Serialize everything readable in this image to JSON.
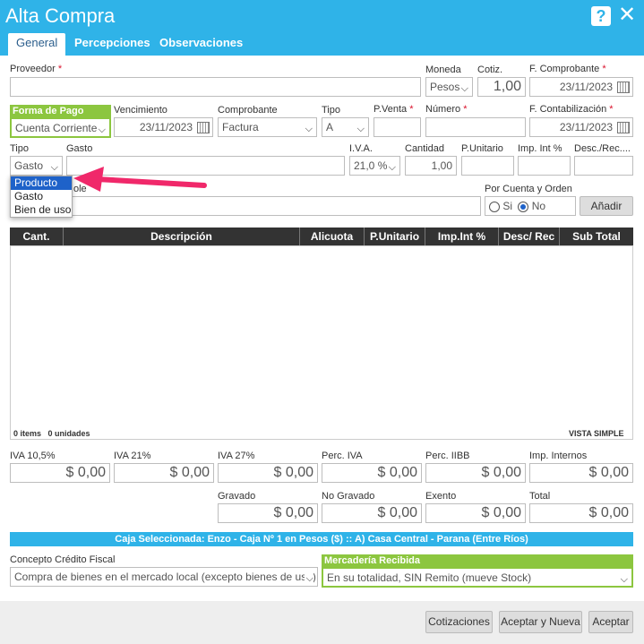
{
  "window": {
    "title": "Alta Compra"
  },
  "tabs": [
    {
      "label": "General"
    },
    {
      "label": "Percepciones"
    },
    {
      "label": "Observaciones"
    }
  ],
  "labels": {
    "proveedor": "Proveedor",
    "moneda": "Moneda",
    "cotiz": "Cotiz.",
    "f_comprobante": "F. Comprobante",
    "forma_pago": "Forma de Pago",
    "vencimiento": "Vencimiento",
    "comprobante": "Comprobante",
    "tipo": "Tipo",
    "pventa": "P.Venta",
    "numero": "Número",
    "f_contabilizacion": "F. Contabilización",
    "tipo2": "Tipo",
    "gasto": "Gasto",
    "iva": "I.V.A.",
    "cantidad": "Cantidad",
    "punitario": "P.Unitario",
    "imp_int": "Imp. Int %",
    "desc_rec": "Desc./Rec....",
    "imputable_suffix": "ole",
    "por_cuenta": "Por Cuenta y Orden",
    "si": "Si",
    "no": "No",
    "required_mark": "*"
  },
  "fields": {
    "proveedor": "",
    "moneda": "Pesos",
    "cotiz": "1,00",
    "f_comprobante": "23/11/2023",
    "forma_pago": "Cuenta Corriente",
    "vencimiento": "23/11/2023",
    "comprobante": "Factura",
    "tipo": "A",
    "pventa": "",
    "numero": "",
    "f_contabilizacion": "23/11/2023",
    "tipo2": "Gasto",
    "gasto": "",
    "iva": "21,0 %",
    "cantidad": "1,00",
    "punitario": "",
    "imp_int": "",
    "desc_rec": "",
    "imputable": ""
  },
  "dropdown": {
    "options": [
      "Producto",
      "Gasto",
      "Bien de uso"
    ],
    "selected": "Producto"
  },
  "buttons": {
    "anadir": "Añadir",
    "cotizaciones": "Cotizaciones",
    "aceptar_nueva": "Aceptar y Nueva",
    "aceptar": "Aceptar"
  },
  "table": {
    "columns": [
      "Cant.",
      "Descripción",
      "Alicuota",
      "P.Unitario",
      "Imp.Int %",
      "Desc/ Rec",
      "Sub Total"
    ],
    "footer_items": "0 items",
    "footer_units": "0 unidades",
    "view_mode": "VISTA SIMPLE"
  },
  "totals": {
    "row1": [
      {
        "label": "IVA 10,5%",
        "value": "$ 0,00"
      },
      {
        "label": "IVA 21%",
        "value": "$ 0,00"
      },
      {
        "label": "IVA 27%",
        "value": "$ 0,00"
      },
      {
        "label": "Perc. IVA",
        "value": "$ 0,00"
      },
      {
        "label": "Perc. IIBB",
        "value": "$ 0,00"
      },
      {
        "label": "Imp. Internos",
        "value": "$ 0,00"
      }
    ],
    "row2": [
      {
        "label": "Gravado",
        "value": "$ 0,00"
      },
      {
        "label": "No Gravado",
        "value": "$ 0,00"
      },
      {
        "label": "Exento",
        "value": "$ 0,00"
      },
      {
        "label": "Total",
        "value": "$ 0,00"
      }
    ]
  },
  "banner": "Caja Seleccionada: Enzo - Caja Nº 1 en Pesos ($) :: A) Casa Central - Parana (Entre Ríos)",
  "bottom": {
    "concepto_label": "Concepto Crédito Fiscal",
    "concepto_value": "Compra de bienes en el mercado local (excepto bienes de uso)",
    "mercaderia_label": "Mercadería Recibida",
    "mercaderia_value": "En su totalidad, SIN Remito (mueve Stock)"
  },
  "colors": {
    "header": "#2fb3e8",
    "green": "#8cc63f",
    "arrow": "#f0286a"
  }
}
